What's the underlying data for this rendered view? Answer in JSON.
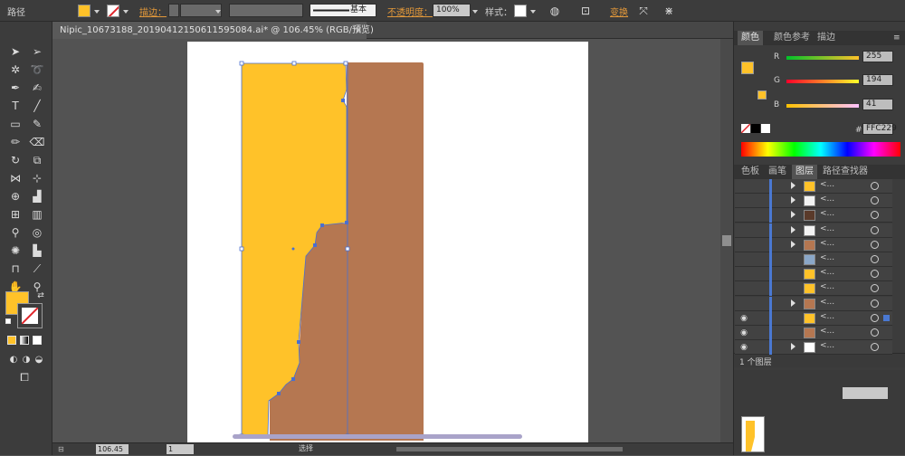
{
  "control_bar": {
    "selection_label": "路径",
    "fill_color": "#FFC229",
    "stroke_label": "描边：",
    "stroke_line_label": "基本",
    "opacity_label": "不透明度：",
    "opacity_value": "100%",
    "style_label": "样式：",
    "transform_label": "变换"
  },
  "document_tab": {
    "title": "Nipic_10673188_20190412150611595084.ai* @ 106.45% (RGB/预览)",
    "close": "×"
  },
  "artwork": {
    "yellow": "#FFC229",
    "brown": "#B57751",
    "selection_color": "#4a6fd0",
    "shadow": "#a9a3c9"
  },
  "status_bar": {
    "zoom": "106.45",
    "page": "1",
    "tool_name": "选择"
  },
  "color_panel": {
    "tabs": [
      "颜色",
      "颜色参考",
      "描边"
    ],
    "r_label": "R",
    "g_label": "G",
    "b_label": "B",
    "r_value": "255",
    "g_value": "194",
    "b_value": "41",
    "hex_label": "#",
    "hex_value": "FFC229"
  },
  "layers_panel": {
    "tabs": [
      "色板",
      "画笔",
      "图层",
      "路径查找器"
    ],
    "layer_count": "1 个图层",
    "row_name": "<..."
  },
  "icons": {
    "visibility": "eye-icon",
    "close": "close-icon",
    "menu": "panel-menu-icon"
  }
}
